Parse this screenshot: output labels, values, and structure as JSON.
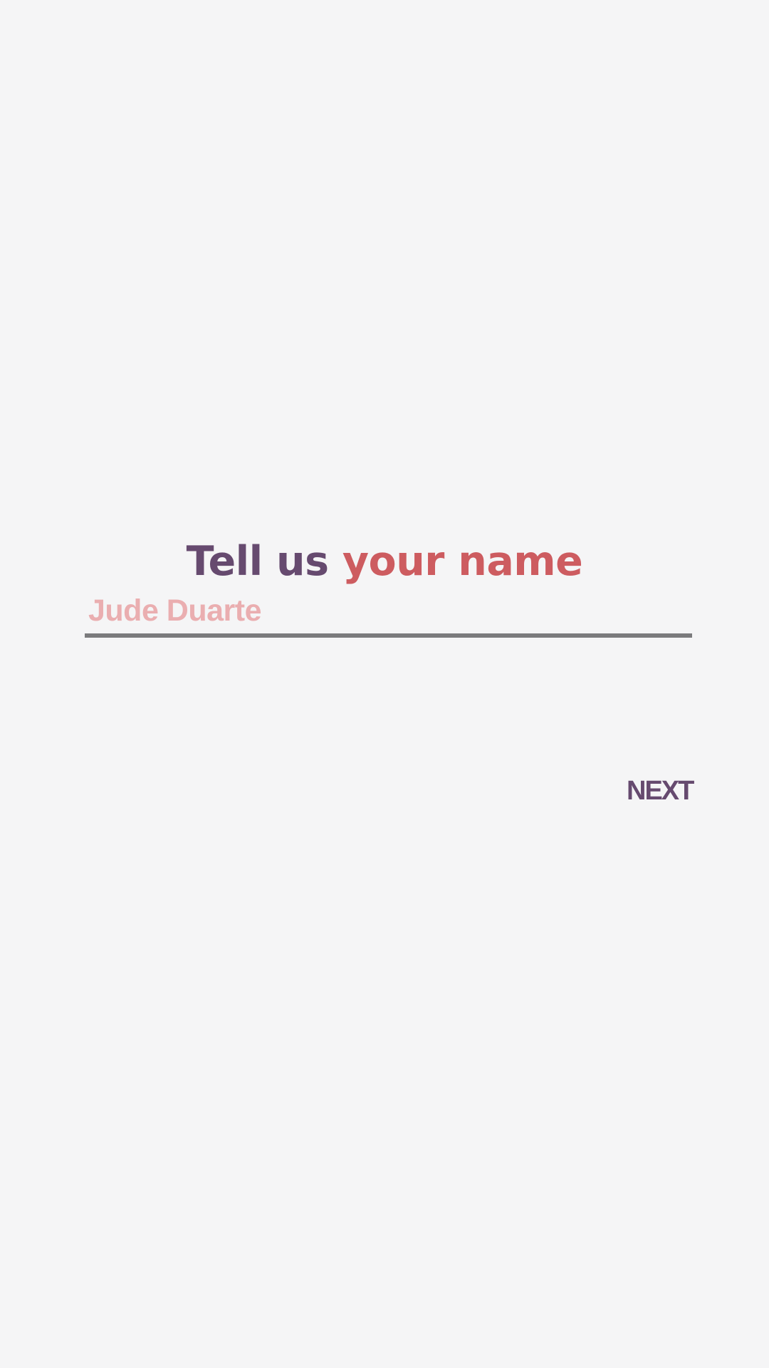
{
  "prompt": {
    "title_part_a": "Tell us ",
    "title_part_b": "your name"
  },
  "name_field": {
    "placeholder": "Jude Duarte",
    "value": ""
  },
  "next_button": {
    "label": "NEXT"
  },
  "colors": {
    "background": "#f5f5f6",
    "primary": "#664a6f",
    "accent": "#cd5c60",
    "placeholder": "#eaaeb0",
    "underline": "#7b7b7d"
  }
}
